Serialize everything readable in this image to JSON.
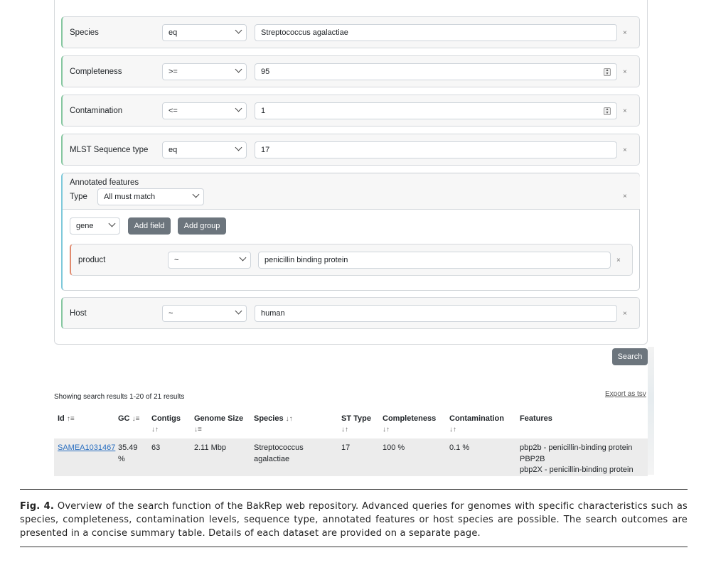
{
  "rules": [
    {
      "field": "Species",
      "operator": "eq",
      "value": "Streptococcus agalactiae",
      "numeric": false
    },
    {
      "field": "Completeness",
      "operator": ">=",
      "value": "95",
      "numeric": true
    },
    {
      "field": "Contamination",
      "operator": "<=",
      "value": "1",
      "numeric": true
    },
    {
      "field": "MLST Sequence type",
      "operator": "eq",
      "value": "17",
      "numeric": false
    }
  ],
  "annotated_group": {
    "title": "Annotated features",
    "type_label": "Type",
    "type_value": "All must match",
    "field_select": "gene",
    "add_field_label": "Add field",
    "add_group_label": "Add group",
    "subrule": {
      "field": "product",
      "operator": "~",
      "value": "penicillin binding protein"
    }
  },
  "host_rule": {
    "field": "Host",
    "operator": "~",
    "value": "human"
  },
  "remove_symbol": "×",
  "search_button": "Search",
  "results": {
    "summary": "Showing search results 1-20 of 21 results",
    "export_label": "Export as tsv",
    "sort_icons": {
      "asc": "↿⇂",
      "both": "⇃↾",
      "desc": "⇂⇃"
    },
    "columns": [
      {
        "line1": "",
        "line2": "Id",
        "sort": "↑≡"
      },
      {
        "line1": "",
        "line2": "GC",
        "sort": "↓≡"
      },
      {
        "line1": "Contigs",
        "line2": "",
        "sort": "↓↑"
      },
      {
        "line1": "Genome Size",
        "line2": "",
        "sort": "↓≡"
      },
      {
        "line1": "",
        "line2": "Species",
        "sort": "↓↑"
      },
      {
        "line1": "ST Type",
        "line2": "",
        "sort": "↓↑"
      },
      {
        "line1": "Completeness",
        "line2": "",
        "sort": "↓↑"
      },
      {
        "line1": "Contamination",
        "line2": "",
        "sort": "↓↑"
      },
      {
        "line1": "",
        "line2": "Features",
        "sort": ""
      }
    ],
    "row": {
      "id": "SAMEA1031467",
      "gc_1": "35.49",
      "gc_2": "%",
      "contigs": "63",
      "genome_size": "2.11 Mbp",
      "species_1": "Streptococcus",
      "species_2": "agalactiae",
      "st_type": "17",
      "completeness": "100 %",
      "contamination": "0.1 %",
      "features": [
        "pbp2b - penicillin-binding protein",
        "PBP2B",
        "pbp2X - penicillin-binding protein"
      ]
    }
  },
  "caption": {
    "label": "Fig. 4.",
    "text": " Overview of the search function of the BakRep web repository. Advanced queries for genomes with specific characteristics such as species, completeness, contamination levels, sequence type, annotated features or host species are possible. The search outcomes are presented in a concise summary table. Details of each dataset are provided on a separate page."
  }
}
